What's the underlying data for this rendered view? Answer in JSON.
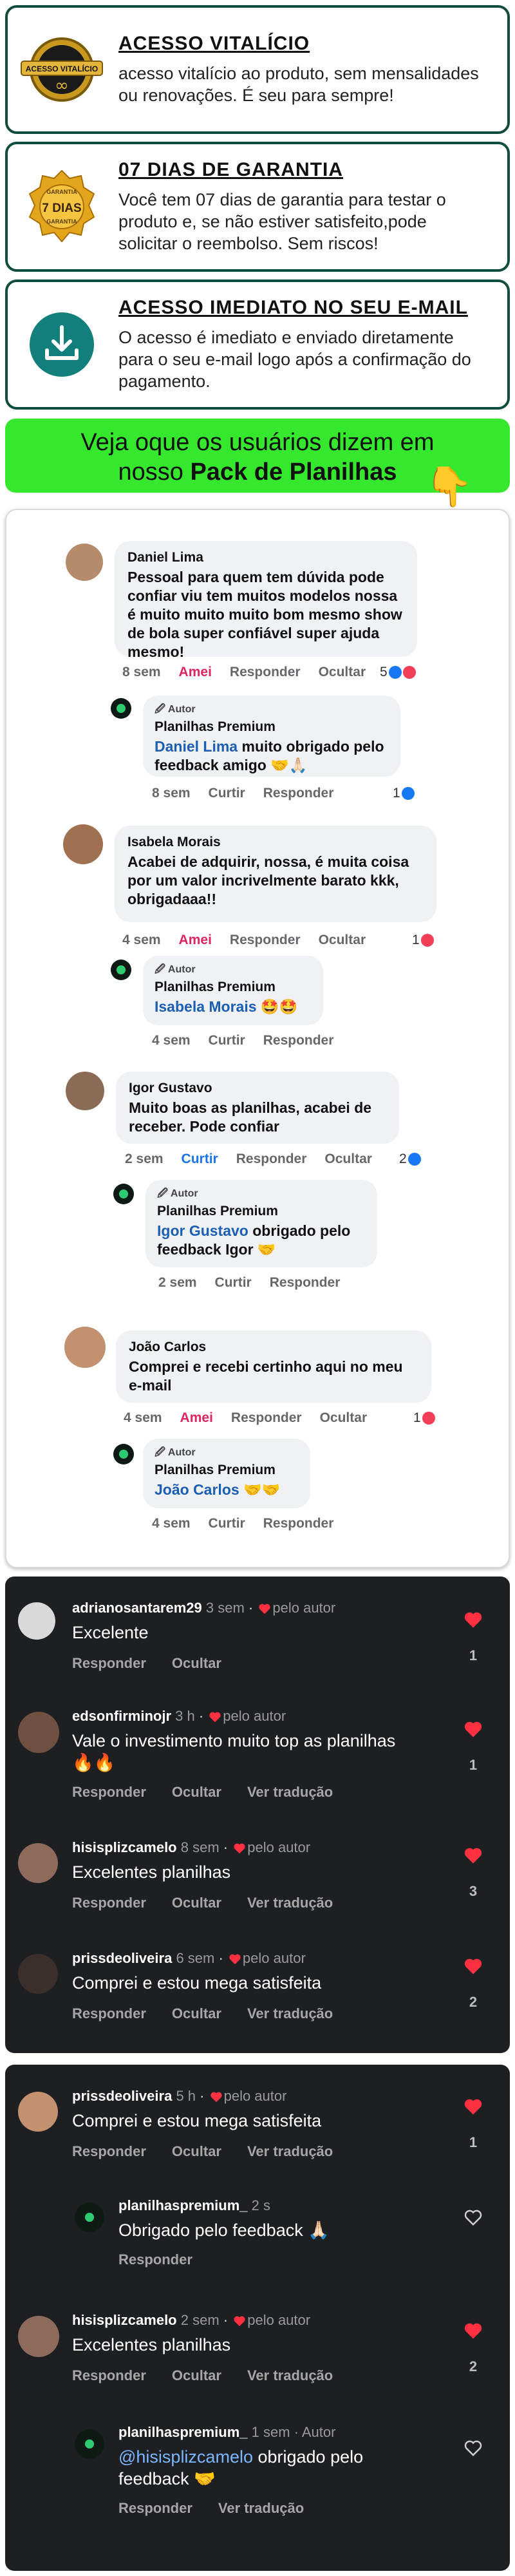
{
  "features": [
    {
      "title": "ACESSO VITALÍCIO",
      "text": "acesso vitalício ao produto, sem mensalidades ou renovações. É seu para sempre!",
      "badge_text": "ACESSO VITALÍCIO"
    },
    {
      "title": "07 DIAS DE GARANTIA",
      "text": "Você tem 07 dias de garantia para testar o produto e, se não estiver satisfeito,pode solicitar o reembolso. Sem riscos!",
      "badge_top": "GARANTIA",
      "badge_text": "7 DIAS",
      "badge_bottom": "GARANTIA"
    },
    {
      "title": "ACESSO IMEDIATO NO SEU E-MAIL",
      "text": "O acesso é imediato e enviado diretamente para o seu e-mail logo após a confirmação do pagamento."
    }
  ],
  "banner": {
    "line1": "Veja oque os usuários dizem em",
    "line2_prefix": "nosso ",
    "line2_bold": "Pack de Planilhas",
    "hand": "👇"
  },
  "fb": {
    "autor_label": "🖉 Autor",
    "page_name": "Planilhas Premium",
    "comments": [
      {
        "name": "Daniel Lima",
        "text": "Pessoal para quem tem dúvida pode confiar viu tem muitos modelos nossa é muito muito muito bom mesmo show de bola super confiável  super ajuda mesmo!",
        "time": "8 sem",
        "like": "Amei",
        "reply": "Responder",
        "hide": "Ocultar",
        "count": "5",
        "reply_obj": {
          "mention": "Daniel Lima",
          "text": " muito obrigado pelo feedback amigo 🤝🙏🏻",
          "time": "8 sem",
          "like": "Curtir",
          "reply": "Responder",
          "count": "1"
        }
      },
      {
        "name": "Isabela Morais",
        "text": "Acabei de adquirir, nossa, é muita coisa por um valor incrivelmente barato kkk, obrigadaaa!!",
        "time": "4 sem",
        "like": "Amei",
        "reply": "Responder",
        "hide": "Ocultar",
        "count": "1",
        "reply_obj": {
          "mention": "Isabela Morais",
          "text": " 🤩🤩",
          "time": "4 sem",
          "like": "Curtir",
          "reply": "Responder"
        }
      },
      {
        "name": "Igor Gustavo",
        "text": "Muito boas as planilhas, acabei de receber. Pode confiar",
        "time": "2 sem",
        "like": "Curtir",
        "reply": "Responder",
        "hide": "Ocultar",
        "count": "2",
        "reply_obj": {
          "mention": "Igor Gustavo",
          "text": " obrigado pelo feedback Igor 🤝",
          "time": "2 sem",
          "like": "Curtir",
          "reply": "Responder"
        }
      },
      {
        "name": "João Carlos",
        "text": "Comprei e recebi certinho aqui no meu e-mail",
        "time": "4 sem",
        "like": "Amei",
        "reply": "Responder",
        "hide": "Ocultar",
        "count": "1",
        "reply_obj": {
          "mention": "João Carlos",
          "text": " 🤝🤝",
          "time": "4 sem",
          "like": "Curtir",
          "reply": "Responder"
        }
      }
    ]
  },
  "ig1": {
    "comments": [
      {
        "user": "adrianosantarem29",
        "meta": "3 sem",
        "by_author": "pelo autor",
        "text": "Excelente",
        "reply": "Responder",
        "hide": "Ocultar",
        "count": "1"
      },
      {
        "user": "edsonfirminojr",
        "meta": "3 h",
        "by_author": "pelo autor",
        "text": "Vale o investimento muito top as planilhas 🔥🔥",
        "reply": "Responder",
        "hide": "Ocultar",
        "translate": "Ver tradução",
        "count": "1"
      },
      {
        "user": "hisisplizcamelo",
        "meta": "8 sem",
        "by_author": "pelo autor",
        "text": "Excelentes planilhas",
        "reply": "Responder",
        "hide": "Ocultar",
        "translate": "Ver tradução",
        "count": "3"
      },
      {
        "user": "prissdeoliveira",
        "meta": "6 sem",
        "by_author": "pelo autor",
        "text": "Comprei e estou mega satisfeita",
        "reply": "Responder",
        "hide": "Ocultar",
        "translate": "Ver tradução",
        "count": "2"
      }
    ]
  },
  "ig2": {
    "comments": [
      {
        "user": "prissdeoliveira",
        "meta": "5 h",
        "by_author": "pelo autor",
        "text": "Comprei e estou mega satisfeita",
        "reply": "Responder",
        "hide": "Ocultar",
        "translate": "Ver tradução",
        "count": "1"
      },
      {
        "user": "planilhaspremium_",
        "meta": "2 s",
        "text": "Obrigado pelo feedback 🙏🏻",
        "reply": "Responder"
      },
      {
        "user": "hisisplizcamelo",
        "meta": "2 sem",
        "by_author": "pelo autor",
        "text": "Excelentes planilhas",
        "reply": "Responder",
        "hide": "Ocultar",
        "translate": "Ver tradução",
        "count": "2"
      },
      {
        "user": "planilhaspremium_",
        "meta": "1 sem · Autor",
        "mention": "@hisisplizcamelo",
        "text": " obrigado pelo feedback 🤝",
        "reply": "Responder",
        "translate": "Ver tradução"
      }
    ]
  }
}
